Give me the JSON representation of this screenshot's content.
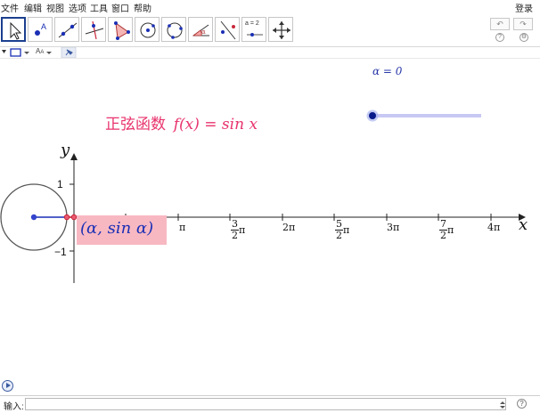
{
  "menu": {
    "items": [
      "文件",
      "编辑",
      "视图",
      "选项",
      "工具",
      "窗口",
      "帮助"
    ],
    "login": "登录"
  },
  "toolbar": {
    "tools": [
      {
        "name": "move-tool",
        "icon": "arrow-pointer-icon",
        "active": true
      },
      {
        "name": "point-tool",
        "icon": "point-a-icon"
      },
      {
        "name": "line-tool",
        "icon": "line-through-points-icon"
      },
      {
        "name": "perpendicular-tool",
        "icon": "perpendicular-line-icon"
      },
      {
        "name": "polygon-tool",
        "icon": "triangle-polygon-icon"
      },
      {
        "name": "circle-center-tool",
        "icon": "circle-center-point-icon"
      },
      {
        "name": "circle-three-points-tool",
        "icon": "circle-three-points-icon"
      },
      {
        "name": "angle-tool",
        "icon": "angle-alpha-icon"
      },
      {
        "name": "reflect-tool",
        "icon": "reflect-line-icon"
      },
      {
        "name": "slider-tool",
        "icon": "slider-a-2-icon",
        "label": "a = 2"
      },
      {
        "name": "move-view-tool",
        "icon": "move-graphics-view-icon"
      }
    ],
    "undo_label": "↶",
    "redo_label": "↷",
    "settings_icon": "gear-icon",
    "help_icon": "question-icon"
  },
  "stylebar": {
    "font_label": "A",
    "font_label_small": "A",
    "pin_icon": "pin-icon"
  },
  "graphics": {
    "slider_label": "α = 0",
    "title": "正弦函数 f(x) = sin x",
    "title_cn": "正弦函数",
    "title_math": "f(x) = sin x",
    "point_label": "(α, sin α)",
    "axis_x_label": "x",
    "axis_y_label": "y",
    "y_ticks": [
      "1",
      "−1"
    ],
    "x_ticks": [
      {
        "label": "π"
      },
      {
        "num": "3",
        "den": "2",
        "suffix": "π"
      },
      {
        "label": "2π"
      },
      {
        "num": "5",
        "den": "2",
        "suffix": "π"
      },
      {
        "label": "3π"
      },
      {
        "num": "7",
        "den": "2",
        "suffix": "π"
      },
      {
        "label": "4π"
      }
    ],
    "alpha_value": 0,
    "slider_range": [
      0,
      12.566
    ],
    "colors": {
      "title": "#e8336d",
      "slider": "#0000aa",
      "slider_track": "#c8c8f5",
      "point": "#c0142a",
      "label_bg": "#f8b8c2"
    }
  },
  "inputbar": {
    "label": "输入:",
    "value": ""
  }
}
